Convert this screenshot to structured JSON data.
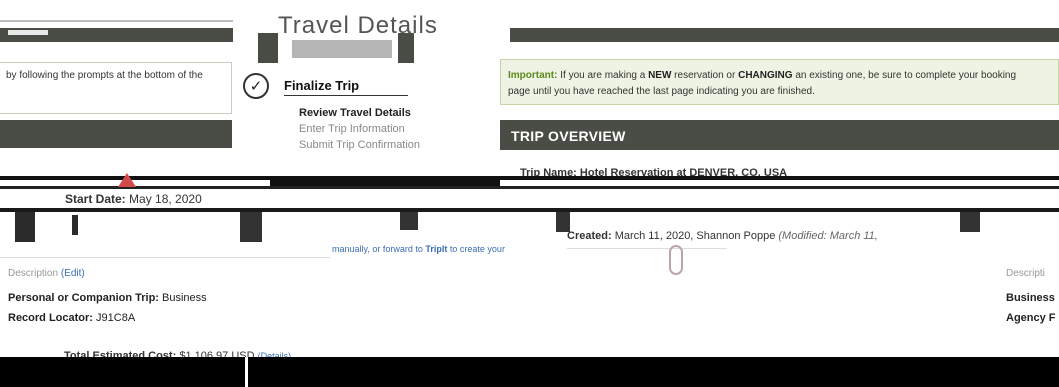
{
  "header": {
    "title_fragment": "Travel Details"
  },
  "left_panel": {
    "instruction_text": "by following the prompts at the bottom of the"
  },
  "wizard": {
    "finalize_title": "Finalize Trip",
    "steps": [
      {
        "label": "Review Travel Details",
        "state": "current"
      },
      {
        "label": "Enter Trip Information",
        "state": "pending"
      },
      {
        "label": "Submit Trip Confirmation",
        "state": "pending"
      }
    ]
  },
  "important": {
    "label": "Important:",
    "text_a": " If you are making a ",
    "new_word": "NEW",
    "text_b": " reservation or ",
    "changing_word": "CHANGING",
    "text_c": " an existing one, be sure to complete your booking",
    "text_d": "page until you have reached the last page indicating you are finished."
  },
  "overview": {
    "title": "TRIP OVERVIEW",
    "trip_name_fragment": "Trip Name: Hotel Reservation at DENVER, CO, USA",
    "start_date_label": "Start Date:",
    "start_date_value": "May 18, 2020",
    "created_label": "Created:",
    "created_value": "March 11, 2020, Shannon Poppe",
    "modified_text": "(Modified: March 11,"
  },
  "details": {
    "description_label": "Description",
    "edit_label": "(Edit)",
    "companion_label": "Personal or Companion Trip:",
    "companion_value": "Business",
    "record_label": "Record Locator:",
    "record_value": "J91C8A",
    "total_label": "Total Estimated Cost:",
    "total_value": "$1,106.97 USD",
    "total_details": "(Details)"
  },
  "tripit": {
    "line1": "manually, or forward to",
    "bold": "TripIt",
    "line2": "to create your"
  },
  "right_fragments": {
    "description": "Descripti",
    "business": "Business",
    "agency": "Agency F"
  },
  "colors": {
    "header_bar": "#4a4d45",
    "important_bg": "#eef3e3",
    "important_label": "#5b8a1e",
    "link": "#3b6fb5"
  }
}
